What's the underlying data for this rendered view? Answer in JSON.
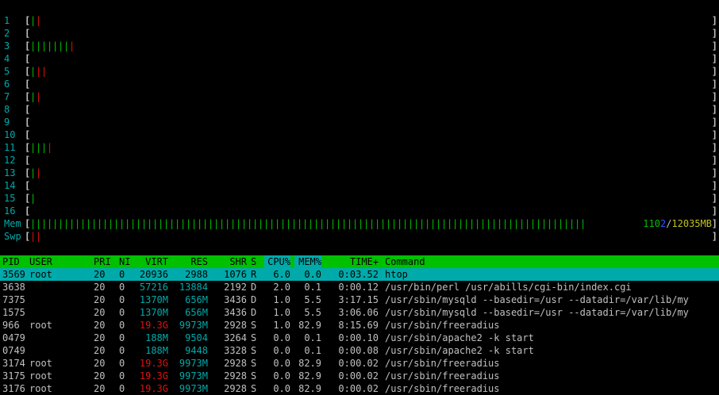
{
  "colors": {
    "green": "#00c000",
    "red": "#e01010",
    "cyan": "#00aaaa",
    "blue": "#3050ff",
    "yellow": "#c0c020"
  },
  "cpus": [
    {
      "label": "1",
      "bars": "gr"
    },
    {
      "label": "2",
      "bars": ""
    },
    {
      "label": "3",
      "bars": "gggggggr"
    },
    {
      "label": "4",
      "bars": ""
    },
    {
      "label": "5",
      "bars": "grr"
    },
    {
      "label": "6",
      "bars": ""
    },
    {
      "label": "7",
      "bars": "gr"
    },
    {
      "label": "8",
      "bars": ""
    },
    {
      "label": "9",
      "bars": ""
    },
    {
      "label": "10",
      "bars": ""
    },
    {
      "label": "11",
      "bars": "gggr"
    },
    {
      "label": "12",
      "bars": ""
    },
    {
      "label": "13",
      "bars": "gr"
    },
    {
      "label": "14",
      "bars": ""
    },
    {
      "label": "15",
      "bars": "g"
    },
    {
      "label": "16",
      "bars": ""
    }
  ],
  "mem": {
    "label": "Mem",
    "used_a": "110",
    "used_b": "2",
    "sep": "/",
    "total": "12035MB",
    "fraction": 0.916
  },
  "swp": {
    "label": "Swp",
    "bars": "rr"
  },
  "header": {
    "pid": "PID",
    "user": "USER",
    "pri": "PRI",
    "ni": "NI",
    "virt": "VIRT",
    "res": "RES",
    "shr": "SHR",
    "s": "S",
    "cpu": "CPU%",
    "mem": "MEM%",
    "time": "TIME+",
    "command": "Command"
  },
  "processes": [
    {
      "pid": "3569",
      "user": "root",
      "pri": "20",
      "ni": "0",
      "virt": "20936",
      "res": "2988",
      "shr": "1076",
      "s": "R",
      "cpu": "6.0",
      "mem": "0.0",
      "time": "0:03.52",
      "command": "htop",
      "selected": true
    },
    {
      "pid": "3638",
      "user": "",
      "pri": "20",
      "ni": "0",
      "virt": "57216",
      "res": "13884",
      "shr": "2192",
      "s": "D",
      "cpu": "2.0",
      "mem": "0.1",
      "time": "0:00.12",
      "command": "/usr/bin/perl /usr/abills/cgi-bin/index.cgi"
    },
    {
      "pid": "7375",
      "user": "",
      "pri": "20",
      "ni": "0",
      "virt": "1370M",
      "res": "656M",
      "shr": "3436",
      "s": "D",
      "cpu": "1.0",
      "mem": "5.5",
      "time": "3:17.15",
      "command": "/usr/sbin/mysqld --basedir=/usr --datadir=/var/lib/my"
    },
    {
      "pid": "1575",
      "user": "",
      "pri": "20",
      "ni": "0",
      "virt": "1370M",
      "res": "656M",
      "shr": "3436",
      "s": "D",
      "cpu": "1.0",
      "mem": "5.5",
      "time": "3:06.06",
      "command": "/usr/sbin/mysqld --basedir=/usr --datadir=/var/lib/my"
    },
    {
      "pid": "966",
      "user": "root",
      "pri": "20",
      "ni": "0",
      "virt": "19.3G",
      "res": "9973M",
      "shr": "2928",
      "s": "S",
      "cpu": "1.0",
      "mem": "82.9",
      "time": "8:15.69",
      "command": "/usr/sbin/freeradius",
      "virt_red": true
    },
    {
      "pid": "0479",
      "user": "",
      "pri": "20",
      "ni": "0",
      "virt": "188M",
      "res": "9504",
      "shr": "3264",
      "s": "S",
      "cpu": "0.0",
      "mem": "0.1",
      "time": "0:00.10",
      "command": "/usr/sbin/apache2 -k start"
    },
    {
      "pid": "0749",
      "user": "",
      "pri": "20",
      "ni": "0",
      "virt": "188M",
      "res": "9448",
      "shr": "3328",
      "s": "S",
      "cpu": "0.0",
      "mem": "0.1",
      "time": "0:00.08",
      "command": "/usr/sbin/apache2 -k start"
    },
    {
      "pid": "3174",
      "user": "root",
      "pri": "20",
      "ni": "0",
      "virt": "19.3G",
      "res": "9973M",
      "shr": "2928",
      "s": "S",
      "cpu": "0.0",
      "mem": "82.9",
      "time": "0:00.02",
      "command": "/usr/sbin/freeradius",
      "virt_red": true
    },
    {
      "pid": "3175",
      "user": "root",
      "pri": "20",
      "ni": "0",
      "virt": "19.3G",
      "res": "9973M",
      "shr": "2928",
      "s": "S",
      "cpu": "0.0",
      "mem": "82.9",
      "time": "0:00.02",
      "command": "/usr/sbin/freeradius",
      "virt_red": true
    },
    {
      "pid": "3176",
      "user": "root",
      "pri": "20",
      "ni": "0",
      "virt": "19.3G",
      "res": "9973M",
      "shr": "2928",
      "s": "S",
      "cpu": "0.0",
      "mem": "82.9",
      "time": "0:00.02",
      "command": "/usr/sbin/freeradius",
      "virt_red": true
    }
  ]
}
